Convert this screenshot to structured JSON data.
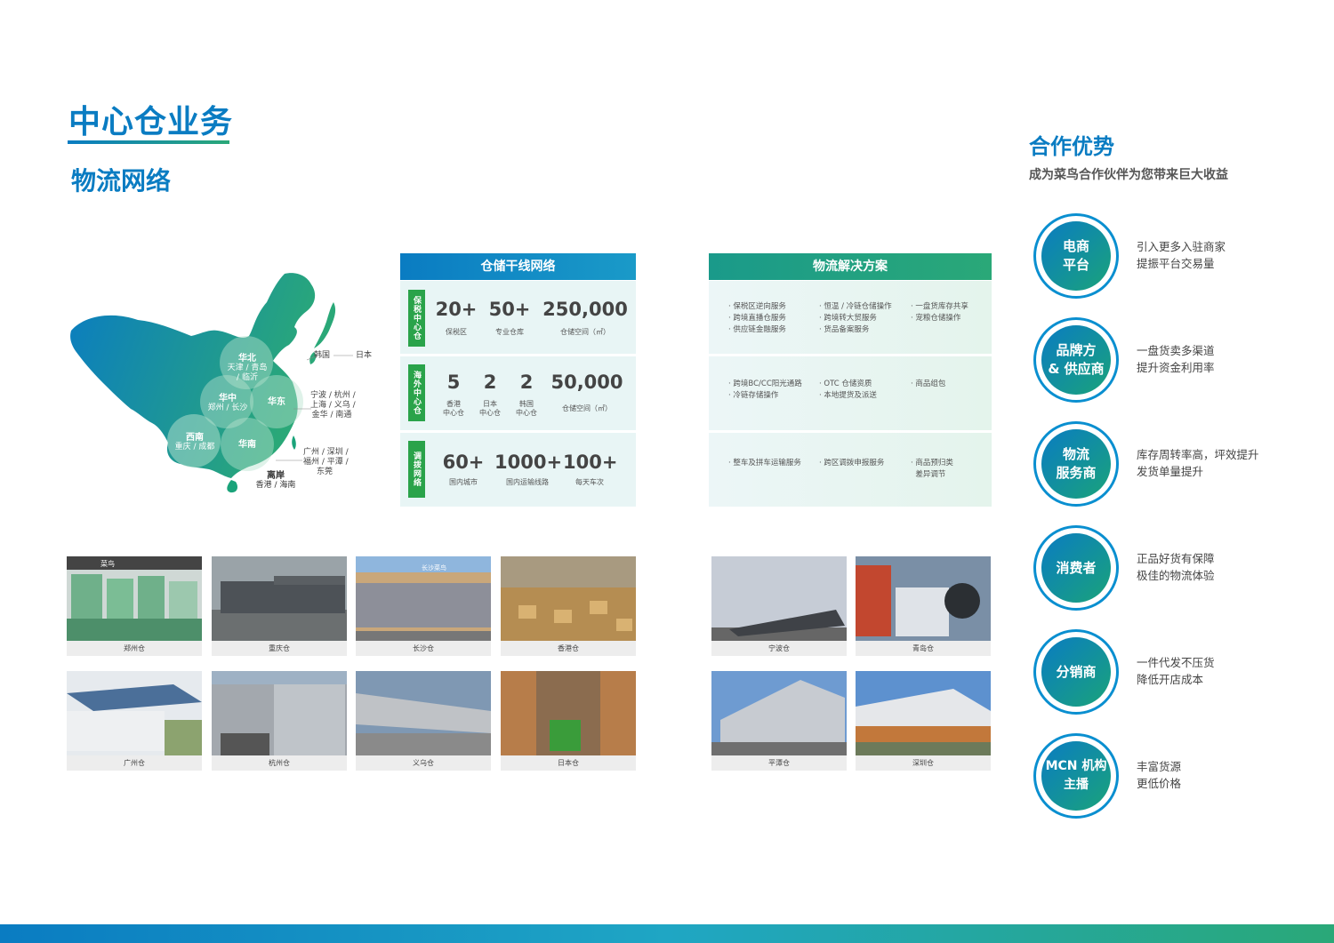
{
  "header": {
    "title": "中心仓业务",
    "subtitle": "物流网络"
  },
  "map": {
    "regions": [
      {
        "name": "华北",
        "cities": "天津 / 青岛 / 临沂"
      },
      {
        "name": "华中",
        "cities": "郑州 / 长沙"
      },
      {
        "name": "华东",
        "cities": ""
      },
      {
        "name": "西南",
        "cities": "重庆 / 成都"
      },
      {
        "name": "华南",
        "cities": ""
      },
      {
        "name": "离岸",
        "cities": "香港 / 海南"
      }
    ],
    "labels": {
      "korea": "韩国",
      "japan": "日本",
      "east_cities": "宁波 / 杭州 /\n上海 / 义乌 /\n金华 / 南通",
      "south_cities": "广州 / 深圳 /\n福州 / 平潭 /\n东莞"
    }
  },
  "storage_table": {
    "title": "仓储干线网络",
    "rows": [
      {
        "tag": "保税中心仓",
        "items": [
          {
            "value": "20+",
            "caption": "保税区"
          },
          {
            "value": "50+",
            "caption": "专业仓库"
          },
          {
            "value": "250,000",
            "caption": "仓储空间（㎡）"
          }
        ]
      },
      {
        "tag": "海外中心仓",
        "items": [
          {
            "value": "5",
            "caption": "香港\n中心仓"
          },
          {
            "value": "2",
            "caption": "日本\n中心仓"
          },
          {
            "value": "2",
            "caption": "韩国\n中心仓"
          },
          {
            "value": "50,000",
            "caption": "仓储空间（㎡）"
          }
        ]
      },
      {
        "tag": "调拨网络",
        "items": [
          {
            "value": "60+",
            "caption": "国内城市"
          },
          {
            "value": "1000+",
            "caption": "国内运输线路"
          },
          {
            "value": "100+",
            "caption": "每天车次"
          }
        ]
      }
    ]
  },
  "solution_table": {
    "title": "物流解决方案",
    "rows": [
      {
        "col1": "· 保税区逆向服务\n· 跨境直播仓服务\n· 供应链金融服务",
        "col2": "· 恒温 / 冷链仓储操作\n· 跨境转大贸服务\n· 货品备案服务",
        "col3": "· 一盘货库存共享\n· 宠粮仓储操作"
      },
      {
        "col1": "· 跨境BC/CC阳光通路\n· 冷链存储操作",
        "col2": "· OTC 仓储资质\n· 本地提货及派送",
        "col3": "· 商品组包"
      },
      {
        "col1": "· 整车及拼车运输服务",
        "col2": "· 跨区调拨申报服务",
        "col3": "· 商品预归类\n  差异调节"
      }
    ]
  },
  "warehouses": {
    "row1": [
      "郑州仓",
      "重庆仓",
      "长沙仓",
      "香港仓",
      "宁波仓",
      "青岛仓"
    ],
    "row2": [
      "广州仓",
      "杭州仓",
      "义乌仓",
      "日本仓",
      "平潭仓",
      "深圳仓"
    ],
    "photo_signs": {
      "zhengzhou": "菜鸟",
      "changsha": "长沙菜鸟"
    }
  },
  "advantages": {
    "title": "合作优势",
    "subtitle": "成为菜鸟合作伙伴为您带来巨大收益",
    "items": [
      {
        "name": "电商\n平台",
        "desc": "引入更多入驻商家\n提振平台交易量"
      },
      {
        "name": "品牌方\n& 供应商",
        "desc": "一盘货卖多渠道\n提升资金利用率"
      },
      {
        "name": "物流\n服务商",
        "desc": "库存周转率高，坪效提升\n发货单量提升"
      },
      {
        "name": "消费者",
        "desc": "正品好货有保障\n极佳的物流体验"
      },
      {
        "name": "分销商",
        "desc": "一件代发不压货\n降低开店成本"
      },
      {
        "name": "MCN 机构\n主播",
        "desc": "丰富货源\n更低价格"
      }
    ]
  },
  "colors": {
    "primary_blue": "#0a7cc2",
    "primary_green": "#2aa878",
    "tag_green": "#2aa34a"
  }
}
